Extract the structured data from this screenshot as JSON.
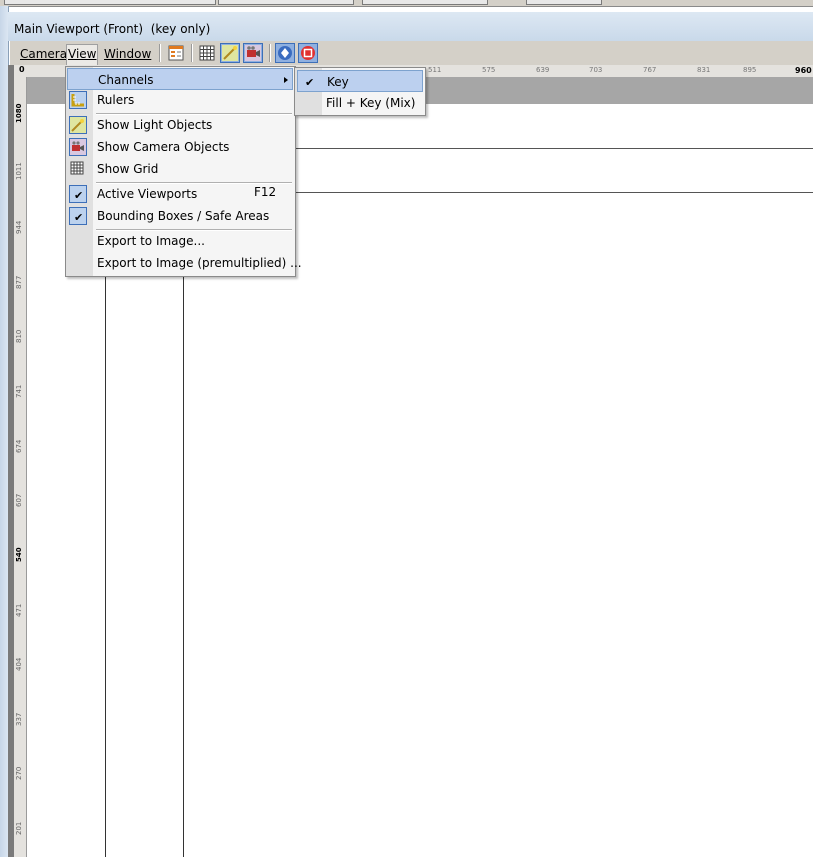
{
  "window": {
    "title": "Main Viewport (Front)  (key only)"
  },
  "menubar": {
    "camera": "Camera",
    "view": "View",
    "window": "Window"
  },
  "toolbar_icons": [
    "layers-icon",
    "grid-icon",
    "light-objects-icon",
    "camera-objects-icon",
    "navigate-icon",
    "stop-icon"
  ],
  "hruler": {
    "start": "0",
    "ticks": [
      "511",
      "575",
      "639",
      "703",
      "767",
      "831",
      "895",
      "960"
    ]
  },
  "vruler": {
    "ticks": [
      "1080",
      "1011",
      "944",
      "877",
      "810",
      "741",
      "674",
      "607",
      "540",
      "471",
      "404",
      "337",
      "270",
      "201"
    ]
  },
  "view_menu": {
    "items": [
      {
        "label": "Channels",
        "has_submenu": true
      },
      {
        "label": "Rulers",
        "icon": "rulers-icon"
      },
      {
        "label": "Show Light Objects",
        "icon": "light-objects-icon"
      },
      {
        "label": "Show Camera Objects",
        "icon": "camera-objects-icon"
      },
      {
        "label": "Show Grid",
        "icon": "grid-icon"
      },
      {
        "label": "Active Viewports",
        "checked": true,
        "shortcut": "F12"
      },
      {
        "label": "Bounding Boxes / Safe Areas",
        "checked": true
      },
      {
        "label": "Export to Image..."
      },
      {
        "label": "Export to Image (premultiplied) ..."
      }
    ]
  },
  "channels_submenu": {
    "items": [
      {
        "label": "Key",
        "checked": true
      },
      {
        "label": "Fill + Key (Mix)",
        "checked": false
      }
    ]
  },
  "colors": {
    "menu_highlight": "#bcd0ef",
    "toolbar_bg": "#d4d0c8",
    "icon_frame": "#3d6fb8"
  }
}
